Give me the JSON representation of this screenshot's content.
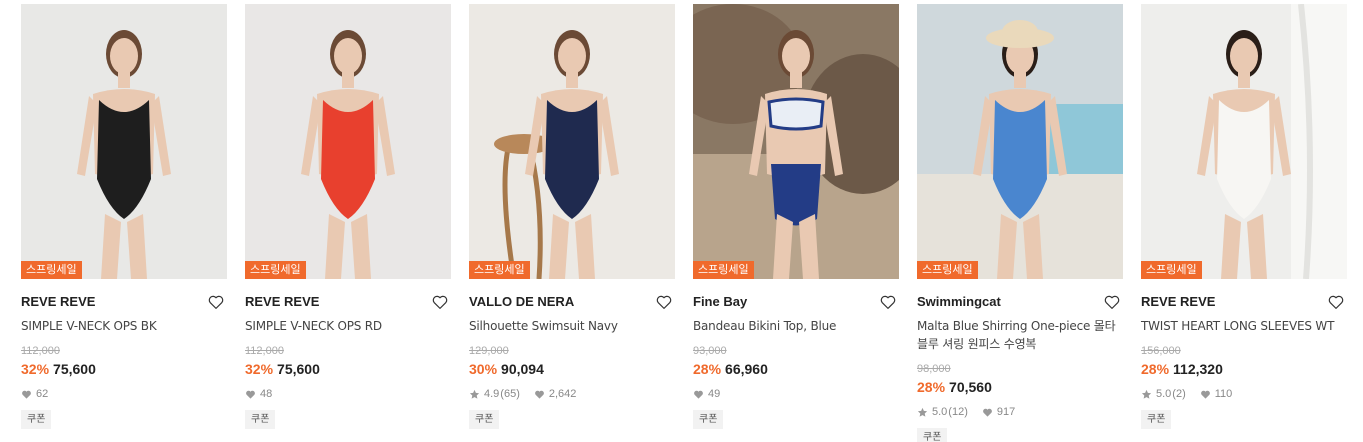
{
  "products": [
    {
      "badge": "스프링세일",
      "brand": "REVE REVE",
      "name": "SIMPLE V-NECK OPS BK",
      "original_price": "112,000",
      "discount": "32%",
      "price": "75,600",
      "rating": "",
      "review_count": "",
      "likes": "62",
      "coupon": "쿠폰",
      "colors": {
        "bg": "#e8e8e6",
        "swim": "#1e1e1e"
      }
    },
    {
      "badge": "스프링세일",
      "brand": "REVE REVE",
      "name": "SIMPLE V-NECK OPS RD",
      "original_price": "112,000",
      "discount": "32%",
      "price": "75,600",
      "rating": "",
      "review_count": "",
      "likes": "48",
      "coupon": "쿠폰",
      "colors": {
        "bg": "#e9e7e6",
        "swim": "#e8402e"
      }
    },
    {
      "badge": "스프링세일",
      "brand": "VALLO DE NERA",
      "name": "Silhouette Swimsuit Navy",
      "original_price": "129,000",
      "discount": "30%",
      "price": "90,094",
      "rating": "4.9",
      "review_count": "(65)",
      "likes": "2,642",
      "coupon": "쿠폰",
      "colors": {
        "bg": "#ece9e4",
        "swim": "#1f2a4f"
      }
    },
    {
      "badge": "스프링세일",
      "brand": "Fine Bay",
      "name": "Bandeau Bikini Top, Blue",
      "original_price": "93,000",
      "discount": "28%",
      "price": "66,960",
      "rating": "",
      "review_count": "",
      "likes": "49",
      "coupon": "쿠폰",
      "colors": {
        "bg": "#8a7864",
        "swim": "#233c86"
      }
    },
    {
      "badge": "스프링세일",
      "brand": "Swimmingcat",
      "name": "Malta Blue Shirring One-piece 몰타 블루 셔링 원피스 수영복",
      "original_price": "98,000",
      "discount": "28%",
      "price": "70,560",
      "rating": "5.0",
      "review_count": "(12)",
      "likes": "917",
      "coupon": "쿠폰",
      "colors": {
        "bg": "#cfd8dc",
        "swim": "#4a86cf"
      }
    },
    {
      "badge": "스프링세일",
      "brand": "REVE REVE",
      "name": "TWIST HEART LONG SLEEVES WT",
      "original_price": "156,000",
      "discount": "28%",
      "price": "112,320",
      "rating": "5.0",
      "review_count": "(2)",
      "likes": "110",
      "coupon": "쿠폰",
      "colors": {
        "bg": "#eeeeec",
        "swim": "#f7f6f3"
      }
    }
  ],
  "icons": {
    "wishlist": "heart-outline-icon",
    "star": "star-icon",
    "like": "heart-filled-icon"
  }
}
